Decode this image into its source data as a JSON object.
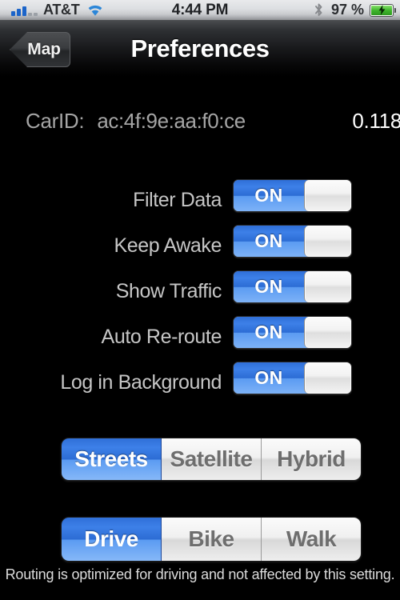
{
  "statusbar": {
    "carrier": "AT&T",
    "signal_icon": "signal-bars-icon",
    "signal_bars_filled": 3,
    "signal_bars_total": 5,
    "wifi_icon": "wifi-icon",
    "time": "4:44 PM",
    "bluetooth_icon": "bluetooth-icon",
    "battery_percent": "97 %",
    "battery_icon": "battery-charging-icon"
  },
  "navbar": {
    "back_label": "Map",
    "back_icon": "back-chevron-icon",
    "title": "Preferences"
  },
  "info": {
    "carid_label": "CarID:",
    "carid_value": "ac:4f:9e:aa:f0:ce",
    "version": "0.118"
  },
  "settings": {
    "rows": [
      {
        "label": "Filter Data",
        "state": "ON"
      },
      {
        "label": "Keep Awake",
        "state": "ON"
      },
      {
        "label": "Show Traffic",
        "state": "ON"
      },
      {
        "label": "Auto Re-route",
        "state": "ON"
      },
      {
        "label": "Log in Background",
        "state": "ON"
      }
    ]
  },
  "map_type": {
    "options": [
      "Streets",
      "Satellite",
      "Hybrid"
    ],
    "selected": "Streets"
  },
  "travel_mode": {
    "options": [
      "Drive",
      "Bike",
      "Walk"
    ],
    "selected": "Drive"
  },
  "footer": {
    "note": "Routing is optimized for driving and not affected  by this setting."
  },
  "colors": {
    "accent_blue": "#3d80e8",
    "background": "#000000",
    "label_gray": "#c6c6c6",
    "battery_green": "#3fb52c"
  }
}
